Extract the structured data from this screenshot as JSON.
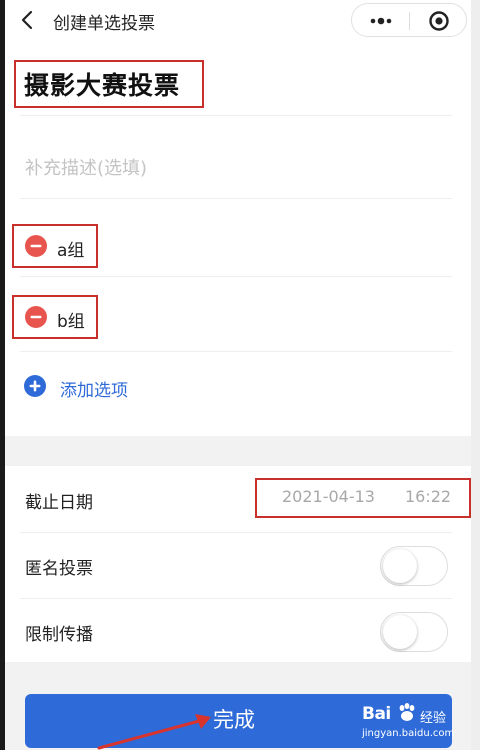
{
  "header": {
    "title": "创建单选投票"
  },
  "form": {
    "title": "摄影大赛投票",
    "description_placeholder": "补充描述(选填)",
    "options": [
      {
        "label": "a组"
      },
      {
        "label": "b组"
      }
    ],
    "add_option_label": "添加选项"
  },
  "settings": {
    "deadline_label": "截止日期",
    "deadline_date": "2021-04-13",
    "deadline_time": "16:22",
    "anonymous_label": "匿名投票",
    "anonymous_on": false,
    "restrict_label": "限制传播",
    "restrict_on": false
  },
  "footer": {
    "done_label": "完成"
  },
  "watermark": {
    "brand": "Bai",
    "brand_suffix": "经验",
    "url": "jingyan.baidu.com"
  },
  "colors": {
    "accent": "#2f6bd8",
    "remove": "#e8554e",
    "highlight": "#c9302c"
  }
}
